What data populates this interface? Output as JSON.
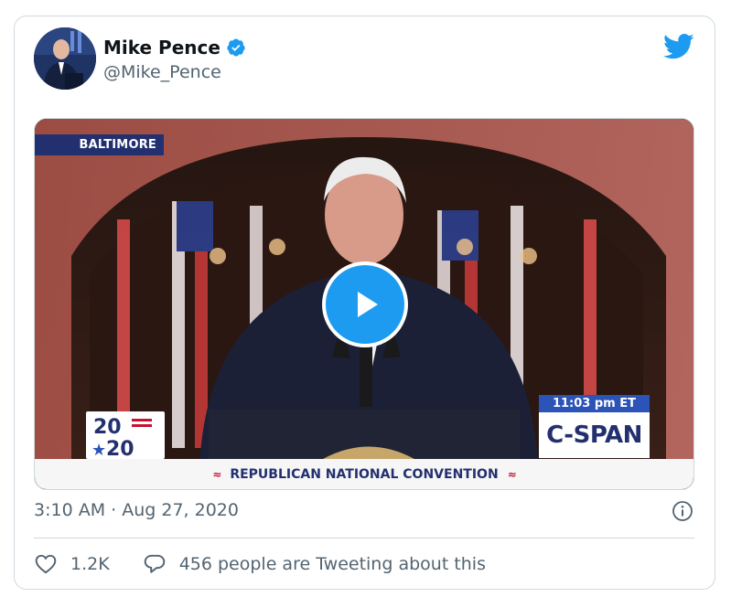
{
  "author": {
    "name": "Mike Pence",
    "handle": "@Mike_Pence"
  },
  "media": {
    "location_tag": "BALTIMORE",
    "logo_top": "20",
    "logo_bottom": "20",
    "time_tag": "11:03 pm ET",
    "network": "C-SPAN",
    "banner": "REPUBLICAN NATIONAL CONVENTION"
  },
  "tweet": {
    "timestamp": "3:10 AM · Aug 27, 2020"
  },
  "actions": {
    "like_count": "1.2K",
    "tweeting_text": "456 people are Tweeting about this"
  },
  "colors": {
    "accent": "#1d9bf0",
    "muted_text": "#536471",
    "cspan_blue": "#23306f",
    "flag_red": "#c8102e"
  }
}
